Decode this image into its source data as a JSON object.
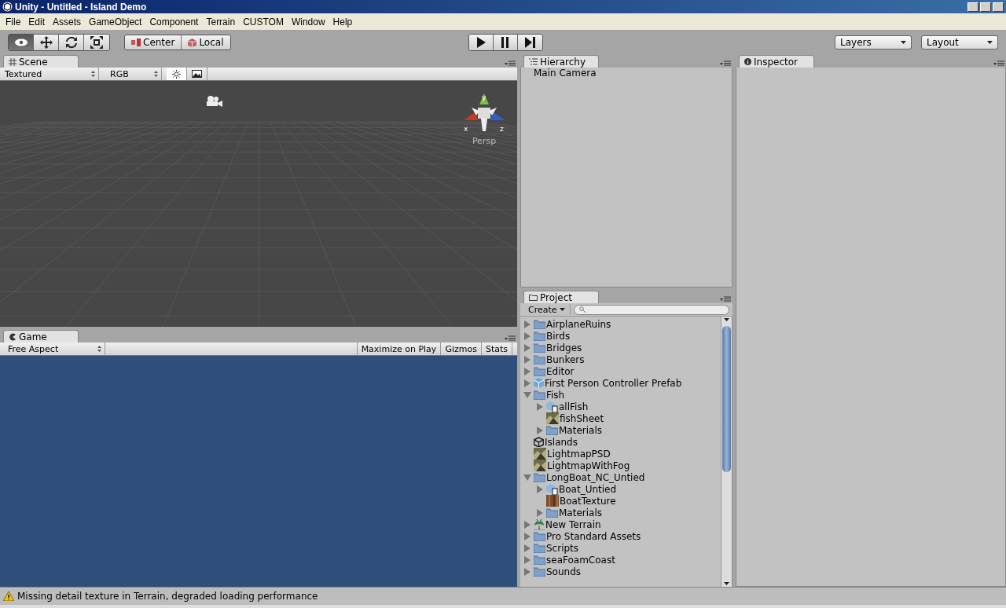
{
  "window": {
    "title": "Unity - Untitled - Island Demo"
  },
  "menu": [
    "File",
    "Edit",
    "Assets",
    "GameObject",
    "Component",
    "Terrain",
    "CUSTOM",
    "Window",
    "Help"
  ],
  "toolbar": {
    "tools": [
      {
        "kind": "view",
        "selected": true
      },
      {
        "kind": "move",
        "selected": false
      },
      {
        "kind": "rotate",
        "selected": false
      },
      {
        "kind": "scale",
        "selected": false
      }
    ],
    "pivot": [
      {
        "kind": "center",
        "label": "Center"
      },
      {
        "kind": "local",
        "label": "Local"
      }
    ],
    "playback": [
      {
        "kind": "play",
        "selected": false
      },
      {
        "kind": "pause",
        "selected": false
      },
      {
        "kind": "step",
        "selected": false
      }
    ],
    "dropdowns": [
      "Layers",
      "Layout"
    ]
  },
  "scene": {
    "tab": "Scene",
    "render_mode": "Textured",
    "channel": "RGB",
    "lighting_on": true,
    "image_effects_on": false,
    "gizmo_label": "Persp",
    "axes": [
      "x",
      "y",
      "z"
    ]
  },
  "game": {
    "tab": "Game",
    "aspect": "Free Aspect",
    "buttons": [
      "Maximize on Play",
      "Gizmos",
      "Stats"
    ]
  },
  "hierarchy": {
    "tab": "Hierarchy",
    "items": [
      "Main Camera"
    ]
  },
  "project": {
    "tab": "Project",
    "create": "Create",
    "items": [
      {
        "kind": "folder",
        "name": "AirplaneRuins",
        "expanded": false
      },
      {
        "kind": "folder",
        "name": "Birds",
        "expanded": false
      },
      {
        "kind": "folder",
        "name": "Bridges",
        "expanded": false
      },
      {
        "kind": "folder",
        "name": "Bunkers",
        "expanded": false
      },
      {
        "kind": "folder",
        "name": "Editor",
        "expanded": false
      },
      {
        "kind": "prefab",
        "name": "First Person Controller Prefab",
        "expanded": false
      },
      {
        "kind": "folder",
        "name": "Fish",
        "expanded": true,
        "children": [
          {
            "kind": "model",
            "name": "allFish",
            "expanded": false
          },
          {
            "kind": "texture",
            "name": "fishSheet"
          },
          {
            "kind": "folder",
            "name": "Materials",
            "expanded": false
          }
        ]
      },
      {
        "kind": "scene",
        "name": "Islands"
      },
      {
        "kind": "texture",
        "name": "LightmapPSD"
      },
      {
        "kind": "texture",
        "name": "LightmapWithFog"
      },
      {
        "kind": "folder",
        "name": "LongBoat_NC_Untied",
        "expanded": true,
        "children": [
          {
            "kind": "model",
            "name": "Boat_Untied",
            "expanded": false
          },
          {
            "kind": "wood",
            "name": "BoatTexture"
          },
          {
            "kind": "folder",
            "name": "Materials",
            "expanded": false
          }
        ]
      },
      {
        "kind": "terrain",
        "name": "New Terrain",
        "expanded": false
      },
      {
        "kind": "folder",
        "name": "Pro Standard Assets",
        "expanded": false
      },
      {
        "kind": "folder",
        "name": "Scripts",
        "expanded": false
      },
      {
        "kind": "folder",
        "name": "seaFoamCoast",
        "expanded": false
      },
      {
        "kind": "folder",
        "name": "Sounds",
        "expanded": false
      }
    ]
  },
  "inspector": {
    "tab": "Inspector"
  },
  "status_bar": {
    "message": "Missing detail texture in Terrain, degraded loading performance"
  }
}
